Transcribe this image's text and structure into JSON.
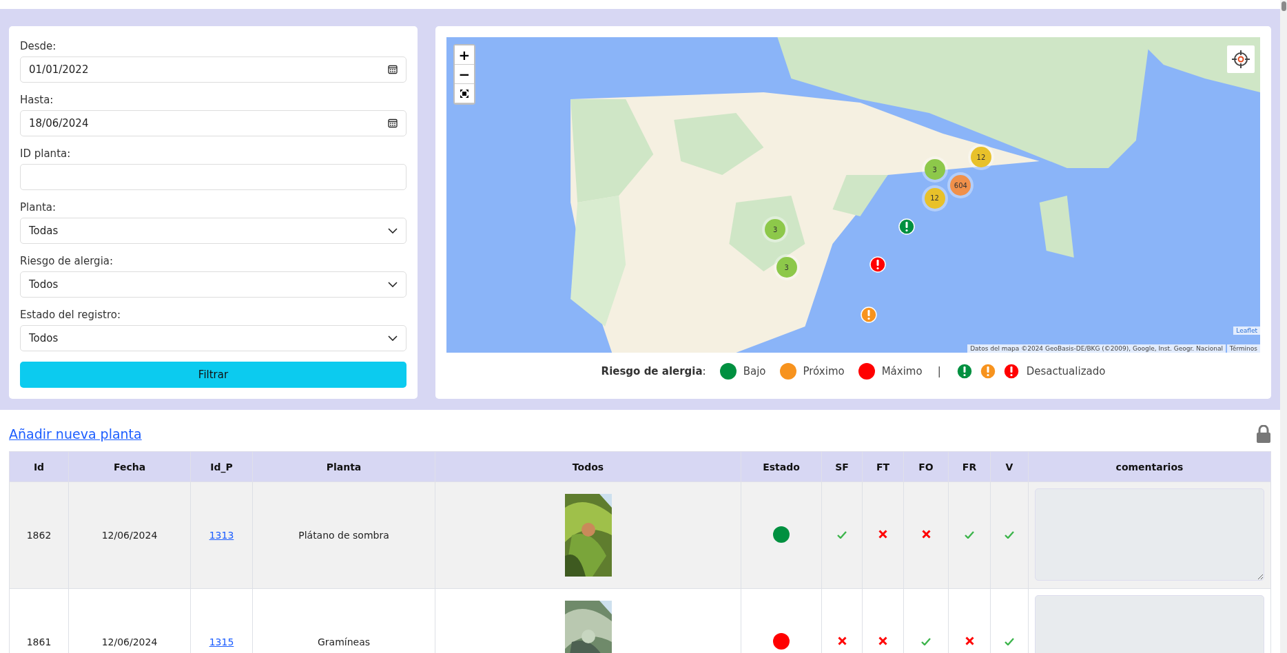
{
  "filters": [
    {
      "label": "Desde:",
      "kind": "date",
      "value": "01/01/2022"
    },
    {
      "label": "Hasta:",
      "kind": "date",
      "value": "18/06/2024"
    },
    {
      "label": "ID planta:",
      "kind": "text"
    },
    {
      "label": "Planta:",
      "kind": "select",
      "value": "Todas"
    },
    {
      "label": "Riesgo de alergia:",
      "kind": "select",
      "value": "Todos"
    },
    {
      "label": "Estado del registro:",
      "kind": "select",
      "value": "Todos"
    }
  ],
  "filter_button": "Filtrar",
  "map": {
    "zoom_in": "+",
    "zoom_out": "−",
    "markers": [
      {
        "kind": "cluster",
        "count": "3",
        "color": "#8dc84a"
      },
      {
        "kind": "cluster",
        "count": "12",
        "color": "#e8c12a"
      },
      {
        "kind": "cluster",
        "count": "604",
        "color": "#f0904a"
      },
      {
        "kind": "cluster",
        "count": "12",
        "color": "#e8c12a"
      },
      {
        "kind": "cluster",
        "count": "3",
        "color": "#8dc84a"
      },
      {
        "kind": "cluster",
        "count": "3",
        "color": "#8dc84a"
      },
      {
        "kind": "alert",
        "color": "#009040"
      },
      {
        "kind": "alert",
        "color": "#ff0000"
      },
      {
        "kind": "alert",
        "color": "#f7931e"
      }
    ],
    "attribution_leaflet": "Leaflet",
    "attribution_data": "Datos del mapa ©2024 GeoBasis-DE/BKG (©2009), Google, Inst. Geogr. Nacional",
    "terms": "Términos"
  },
  "legend": {
    "title": "**Riesgo de alergia**:",
    "items": [
      {
        "kind": "dot",
        "label": "Bajo",
        "color": "#009040"
      },
      {
        "kind": "dot",
        "label": "Próximo",
        "color": "#f7931e"
      },
      {
        "kind": "dot",
        "label": "Máximo",
        "color": "#ff0000"
      },
      {
        "kind": "separator",
        "label": "|"
      },
      {
        "kind": "alert",
        "color": "#009040"
      },
      {
        "kind": "alert",
        "color": "#f7931e"
      },
      {
        "kind": "alert",
        "color": "#ff0000"
      },
      {
        "kind": "text",
        "label": "Desactualizado"
      }
    ]
  },
  "add_link": "Añadir nueva planta",
  "table": {
    "columns": [
      "Id",
      "Fecha",
      "Id_P",
      "Planta",
      "Todos",
      "Estado",
      "SF",
      "FT",
      "FO",
      "FR",
      "V",
      "comentarios"
    ],
    "rows": [
      {
        "id": "1862",
        "fecha": "12/06/2024",
        "id_p": "1313",
        "planta": "Plátano de sombra",
        "estado": {
          "color": "#009040"
        },
        "sf": true,
        "ft": false,
        "fo": false,
        "fr": true,
        "v": true
      },
      {
        "id": "1861",
        "fecha": "12/06/2024",
        "id_p": "1315",
        "planta": "Gramíneas",
        "estado": {
          "color": "#ff0000"
        },
        "sf": false,
        "ft": false,
        "fo": true,
        "fr": false,
        "v": true
      }
    ]
  }
}
